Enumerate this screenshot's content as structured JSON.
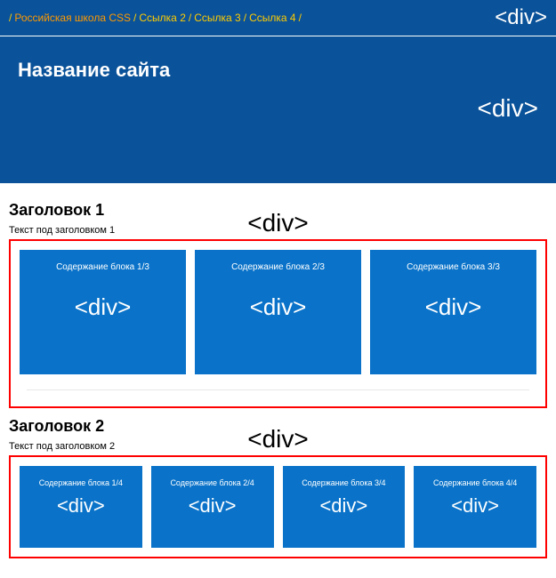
{
  "topbar": {
    "crumbs": [
      {
        "text": "Российская школа CSS",
        "active": true
      },
      {
        "text": "Ссылка 2",
        "active": false
      },
      {
        "text": "Ссылка 3",
        "active": false
      },
      {
        "text": "Ссылка 4",
        "active": false
      }
    ],
    "sep": "/",
    "tag": "<div>"
  },
  "header": {
    "title": "Название сайта",
    "tag": "<div>"
  },
  "section1": {
    "title": "Заголовок 1",
    "sub": "Текст под заголовком 1",
    "tag": "<div>",
    "blocks": [
      {
        "label": "Содержание блока 1/3",
        "tag": "<div>"
      },
      {
        "label": "Содержание блока 2/3",
        "tag": "<div>"
      },
      {
        "label": "Содержание блока 3/3",
        "tag": "<div>"
      }
    ]
  },
  "section2": {
    "title": "Заголовок 2",
    "sub": "Текст под заголовком 2",
    "tag": "<div>",
    "blocks": [
      {
        "label": "Содержание блока 1/4",
        "tag": "<div>"
      },
      {
        "label": "Содержание блока 2/4",
        "tag": "<div>"
      },
      {
        "label": "Содержание блока 3/4",
        "tag": "<div>"
      },
      {
        "label": "Содержание блока 4/4",
        "tag": "<div>"
      }
    ]
  }
}
